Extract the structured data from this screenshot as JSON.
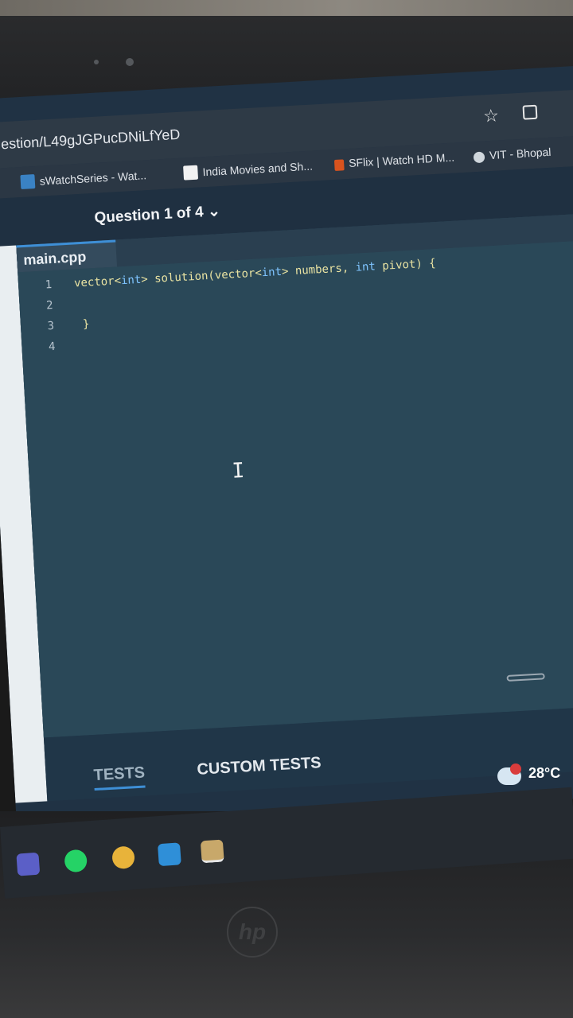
{
  "browser": {
    "url": "estion/L49gJGPucDNiLfYeD"
  },
  "bookmarks": [
    {
      "label": "sWatchSeries - Wat..."
    },
    {
      "label": "India Movies and Sh..."
    },
    {
      "label": "SFlix | Watch HD M..."
    },
    {
      "label": "VIT - Bhopal"
    }
  ],
  "question": {
    "title": "Question 1 of 4"
  },
  "editor": {
    "file_tab": "main.cpp",
    "lines": [
      {
        "number": "1",
        "code": "vector<int> solution(vector<int> numbers, int pivot) {"
      },
      {
        "number": "2",
        "code": ""
      },
      {
        "number": "3",
        "code": "}"
      },
      {
        "number": "4",
        "code": ""
      }
    ]
  },
  "bottom_tabs": {
    "tests": "TESTS",
    "custom_tests": "CUSTOM TESTS"
  },
  "weather": {
    "temp": "28°C",
    "badge": "1"
  },
  "colors": {
    "accent": "#3e8fd6",
    "editor_bg": "#2a4858"
  }
}
